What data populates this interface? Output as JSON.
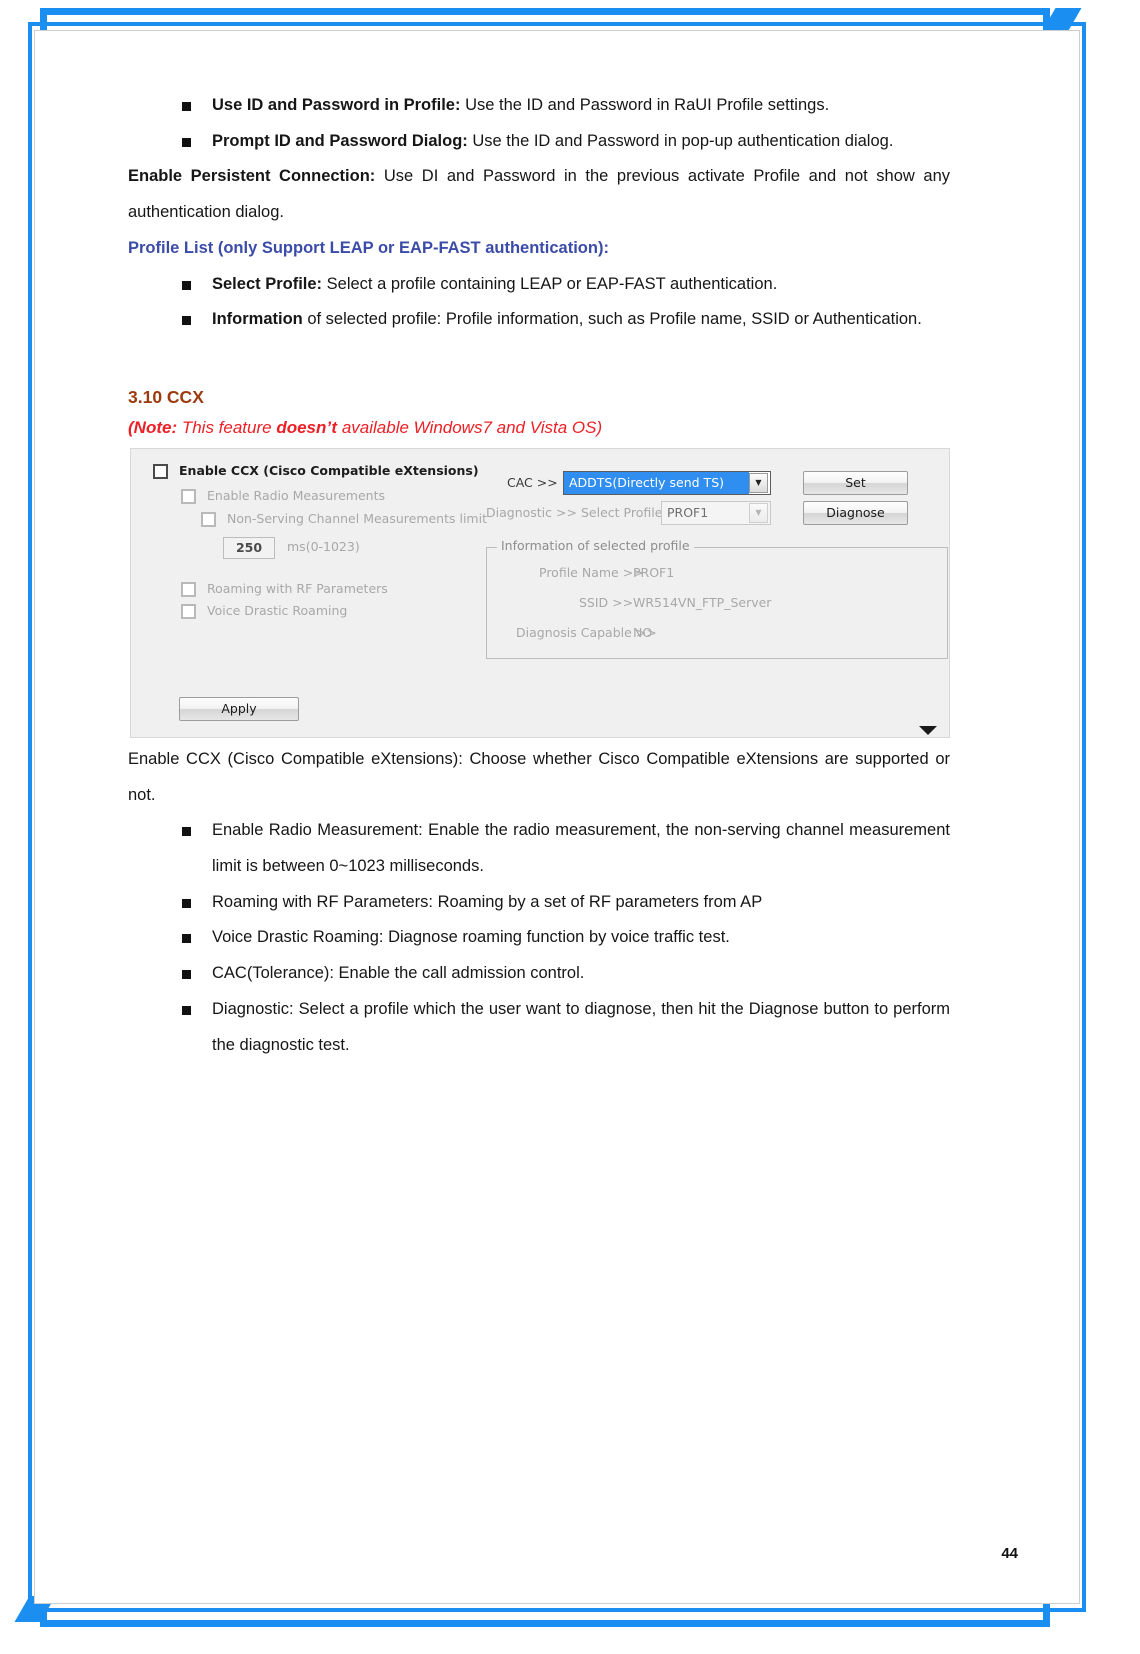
{
  "page": {
    "number": "44"
  },
  "intro_bullets": [
    {
      "bold": "Use ID and Password in Profile:",
      "rest": " Use the ID and Password in RaUI Profile settings."
    },
    {
      "bold": "Prompt ID and Password Dialog:",
      "rest": " Use the ID and Password in pop-up authentication dialog."
    }
  ],
  "persistent": {
    "bold": "Enable Persistent Connection:",
    "rest": " Use DI and Password in the previous activate Profile and not show any authentication dialog."
  },
  "profile_list_heading": "Profile List (only Support LEAP or EAP-FAST authentication):",
  "profile_bullets": [
    {
      "bold": "Select Profile:",
      "rest": " Select a profile containing LEAP or EAP-FAST authentication."
    },
    {
      "bold": "Information",
      "rest": " of selected profile: Profile information, such as Profile name, SSID or Authentication."
    }
  ],
  "section": {
    "heading": "3.10 CCX",
    "note_prefix": "(Note:",
    "note_mid": " This feature ",
    "note_bold": "doesn’t",
    "note_rest": " available Windows7 and Vista OS)"
  },
  "screenshot": {
    "checkboxes": [
      {
        "label": "Enable CCX (Cisco Compatible eXtensions)",
        "checked": false,
        "dim": false
      },
      {
        "label": "Enable Radio Measurements",
        "checked": false,
        "dim": true
      },
      {
        "label": "Non-Serving Channel Measurements limit",
        "checked": false,
        "dim": true
      },
      {
        "label": "Roaming with RF Parameters",
        "checked": false,
        "dim": true
      },
      {
        "label": "Voice Drastic Roaming",
        "checked": false,
        "dim": true
      }
    ],
    "ms_value": "250",
    "ms_unit": "ms(0-1023)",
    "cac_label": "CAC >>",
    "cac_value": "ADDTS(Directly send TS)",
    "set_button": "Set",
    "diagnostic_label": "Diagnostic >>",
    "select_profile_label": "Select Profile",
    "select_profile_value": "PROF1",
    "diagnose_button": "Diagnose",
    "group_title": "Information of selected profile",
    "info_rows": [
      {
        "label": "Profile Name >>",
        "value": "PROF1"
      },
      {
        "label": "SSID >>",
        "value": "WR514VN_FTP_Server"
      },
      {
        "label": "Diagnosis Capable >>",
        "value": "NO"
      }
    ],
    "apply_button": "Apply"
  },
  "ccx_paragraph": "Enable CCX (Cisco Compatible eXtensions): Choose whether Cisco Compatible eXtensions are supported or not.",
  "ccx_bullets": [
    "Enable Radio Measurement: Enable the radio measurement, the non-serving channel measurement limit is between 0~1023 milliseconds.",
    "Roaming with RF Parameters: Roaming by a set of RF parameters from AP",
    "Voice Drastic Roaming: Diagnose roaming function by voice traffic test.",
    "CAC(Tolerance): Enable the call admission control.",
    "Diagnostic: Select a profile which the user want to diagnose, then hit the Diagnose button to perform the diagnostic test."
  ],
  "colors": {
    "frame_blue": "#1b8ef2",
    "heading_blue": "#3b4ba8",
    "section_brown": "#9c3b10",
    "note_red": "#ec2026",
    "combo_highlight": "#2f8ef0"
  }
}
